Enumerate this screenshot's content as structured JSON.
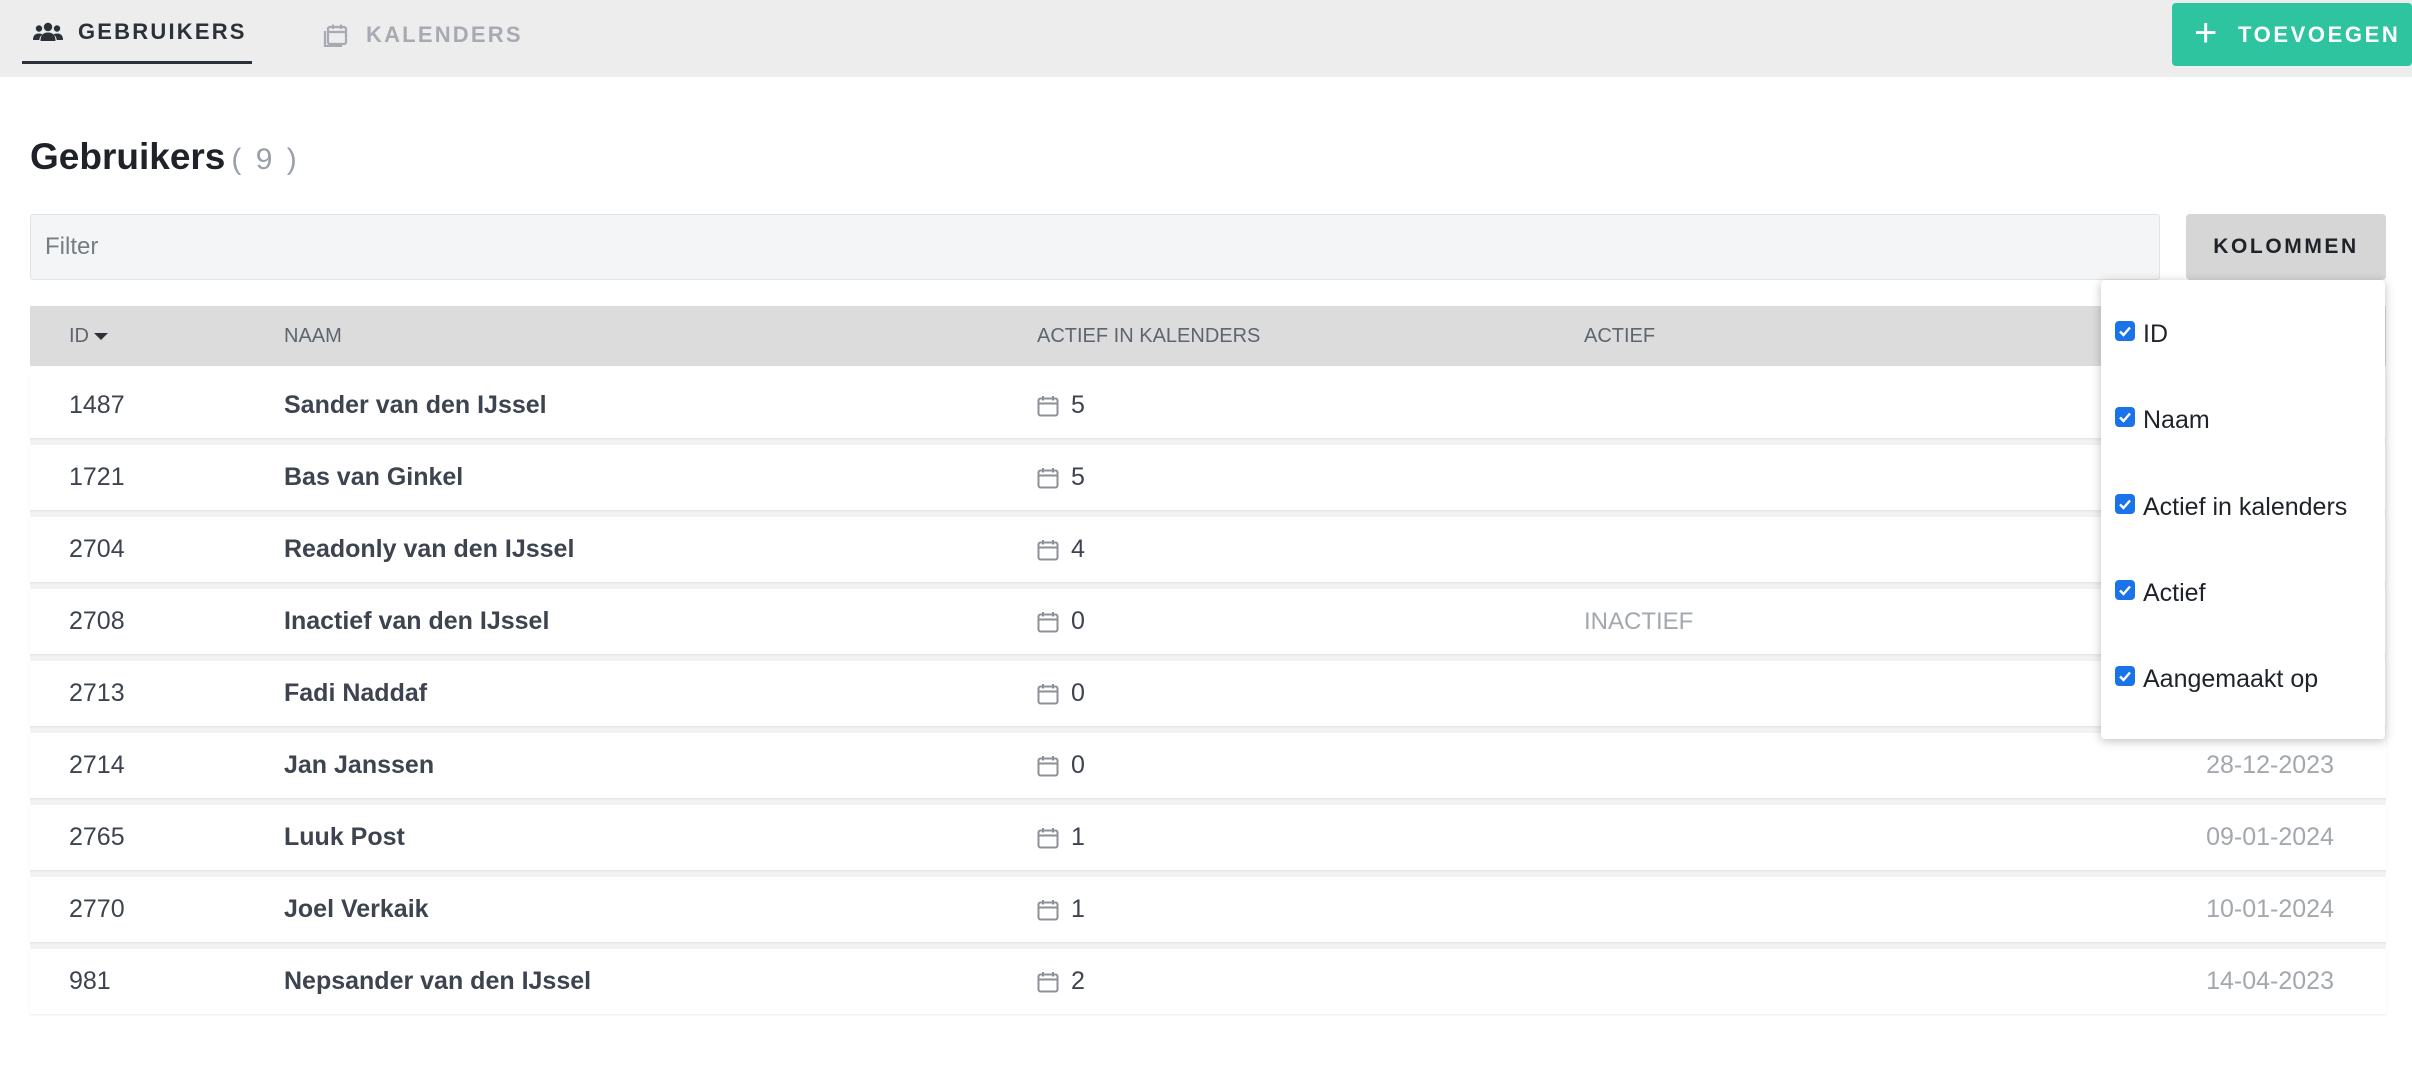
{
  "tabs": [
    {
      "label": "GEBRUIKERS",
      "icon": "users-icon",
      "active": true
    },
    {
      "label": "KALENDERS",
      "icon": "calendars-icon",
      "active": false
    }
  ],
  "add_button": {
    "label": "TOEVOEGEN",
    "icon": "plus-icon",
    "color": "#2ec4a0"
  },
  "page": {
    "title": "Gebruikers",
    "count": "( 9 )"
  },
  "filter": {
    "placeholder": "Filter",
    "value": ""
  },
  "columns_button": {
    "label": "KOLOMMEN"
  },
  "table": {
    "headers": {
      "id": "ID",
      "name": "NAAM",
      "active_in_calendars": "ACTIEF IN KALENDERS",
      "active": "ACTIEF"
    },
    "sort": {
      "column": "ID",
      "direction": "descending"
    },
    "rows": [
      {
        "id": "1487",
        "name": "Sander van den IJssel",
        "calendars": "5",
        "active": "",
        "created": ""
      },
      {
        "id": "1721",
        "name": "Bas van Ginkel",
        "calendars": "5",
        "active": "",
        "created": ""
      },
      {
        "id": "2704",
        "name": "Readonly van den IJssel",
        "calendars": "4",
        "active": "",
        "created": ""
      },
      {
        "id": "2708",
        "name": "Inactief van den IJssel",
        "calendars": "0",
        "active": "INACTIEF",
        "created": ""
      },
      {
        "id": "2713",
        "name": "Fadi Naddaf",
        "calendars": "0",
        "active": "",
        "created": ""
      },
      {
        "id": "2714",
        "name": "Jan Janssen",
        "calendars": "0",
        "active": "",
        "created": "28-12-2023"
      },
      {
        "id": "2765",
        "name": "Luuk Post",
        "calendars": "1",
        "active": "",
        "created": "09-01-2024"
      },
      {
        "id": "2770",
        "name": "Joel Verkaik",
        "calendars": "1",
        "active": "",
        "created": "10-01-2024"
      },
      {
        "id": "981",
        "name": "Nepsander van den IJssel",
        "calendars": "2",
        "active": "",
        "created": "14-04-2023"
      }
    ]
  },
  "columns_menu": {
    "options": [
      {
        "label": "ID",
        "checked": true
      },
      {
        "label": "Naam",
        "checked": true
      },
      {
        "label": "Actief in kalenders",
        "checked": true
      },
      {
        "label": "Actief",
        "checked": true
      },
      {
        "label": "Aangemaakt op",
        "checked": true
      }
    ]
  }
}
